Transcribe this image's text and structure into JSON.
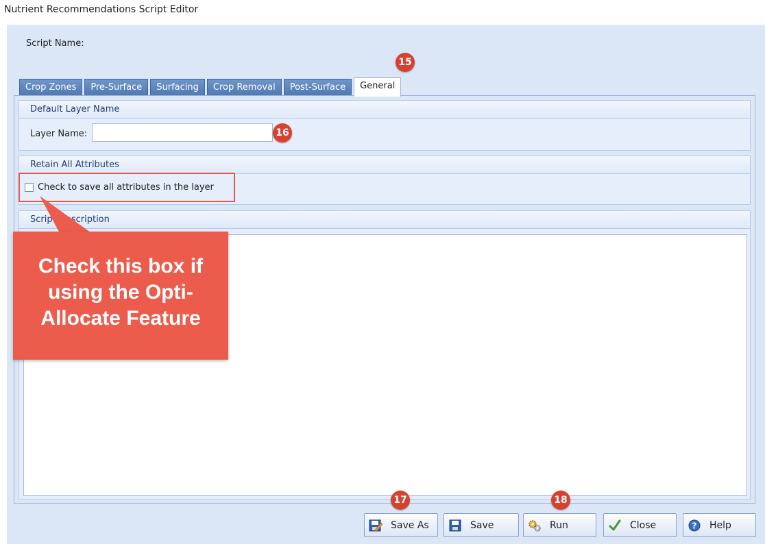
{
  "window": {
    "title": "Nutrient Recommendations Script Editor"
  },
  "form": {
    "script_name_label": "Script Name:"
  },
  "tabs": [
    {
      "label": "Crop Zones"
    },
    {
      "label": "Pre-Surface"
    },
    {
      "label": "Surfacing"
    },
    {
      "label": "Crop Removal"
    },
    {
      "label": "Post-Surface"
    },
    {
      "label": "General"
    }
  ],
  "groups": {
    "default_layer": {
      "title": "Default Layer Name",
      "field_label": "Layer Name:",
      "value": ""
    },
    "retain": {
      "title": "Retain All Attributes",
      "checkbox_label": "Check to save all attributes in the layer",
      "checked": false
    },
    "description": {
      "title": "Script Description",
      "value": ""
    }
  },
  "buttons": {
    "save_as": "Save As",
    "save": "Save",
    "run": "Run",
    "close": "Close",
    "help": "Help"
  },
  "annotations": {
    "badge_general": "15",
    "badge_layer": "16",
    "badge_save_as": "17",
    "badge_run": "18",
    "callout_line1": "Check this box if",
    "callout_line2": "using the Opti-",
    "callout_line3": "Allocate Feature",
    "color": "#ec5c4d"
  }
}
